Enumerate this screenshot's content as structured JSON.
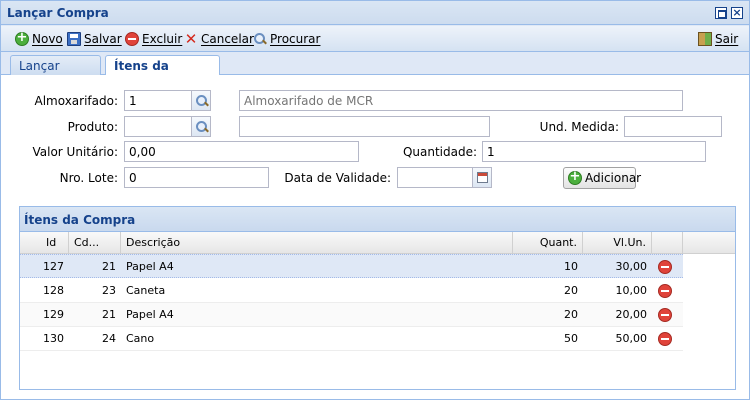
{
  "window": {
    "title": "Lançar Compra"
  },
  "toolbar": {
    "novo": "Novo",
    "salvar": "Salvar",
    "excluir": "Excluir",
    "cancelar": "Cancelar",
    "procurar": "Procurar",
    "sair": "Sair"
  },
  "tabs": [
    "Lançar Compra",
    "Ítens da Compra"
  ],
  "form": {
    "almoxarifado": {
      "label": "Almoxarifado:",
      "value": "1",
      "desc_placeholder": "Almoxarifado de MCR"
    },
    "produto": {
      "label": "Produto:",
      "value": "",
      "desc_value": ""
    },
    "und_medida": {
      "label": "Und. Medida:",
      "value": ""
    },
    "valor_unitario": {
      "label": "Valor Unitário:",
      "value": "0,00"
    },
    "quantidade": {
      "label": "Quantidade:",
      "value": "1"
    },
    "nro_lote": {
      "label": "Nro. Lote:",
      "value": "0"
    },
    "data_validade": {
      "label": "Data de Validade:",
      "value": ""
    },
    "adicionar": "Adicionar"
  },
  "grid": {
    "title": "Ítens da Compra",
    "columns": [
      "Id",
      "Cd...",
      "Descrição",
      "Quant.",
      "Vl.Un."
    ],
    "rows": [
      {
        "id": "127",
        "cd": "21",
        "descricao": "Papel A4",
        "quant": "10",
        "vlun": "30,00"
      },
      {
        "id": "128",
        "cd": "23",
        "descricao": "Caneta",
        "quant": "20",
        "vlun": "10,00"
      },
      {
        "id": "129",
        "cd": "21",
        "descricao": "Papel A4",
        "quant": "20",
        "vlun": "20,00"
      },
      {
        "id": "130",
        "cd": "24",
        "descricao": "Cano",
        "quant": "50",
        "vlun": "50,00"
      }
    ]
  },
  "colors": {
    "title_text": "#15428b",
    "border": "#99bbe8",
    "panel_bg": "#dfe8f6",
    "remove": "#e0433a",
    "add": "#4caf3d"
  }
}
